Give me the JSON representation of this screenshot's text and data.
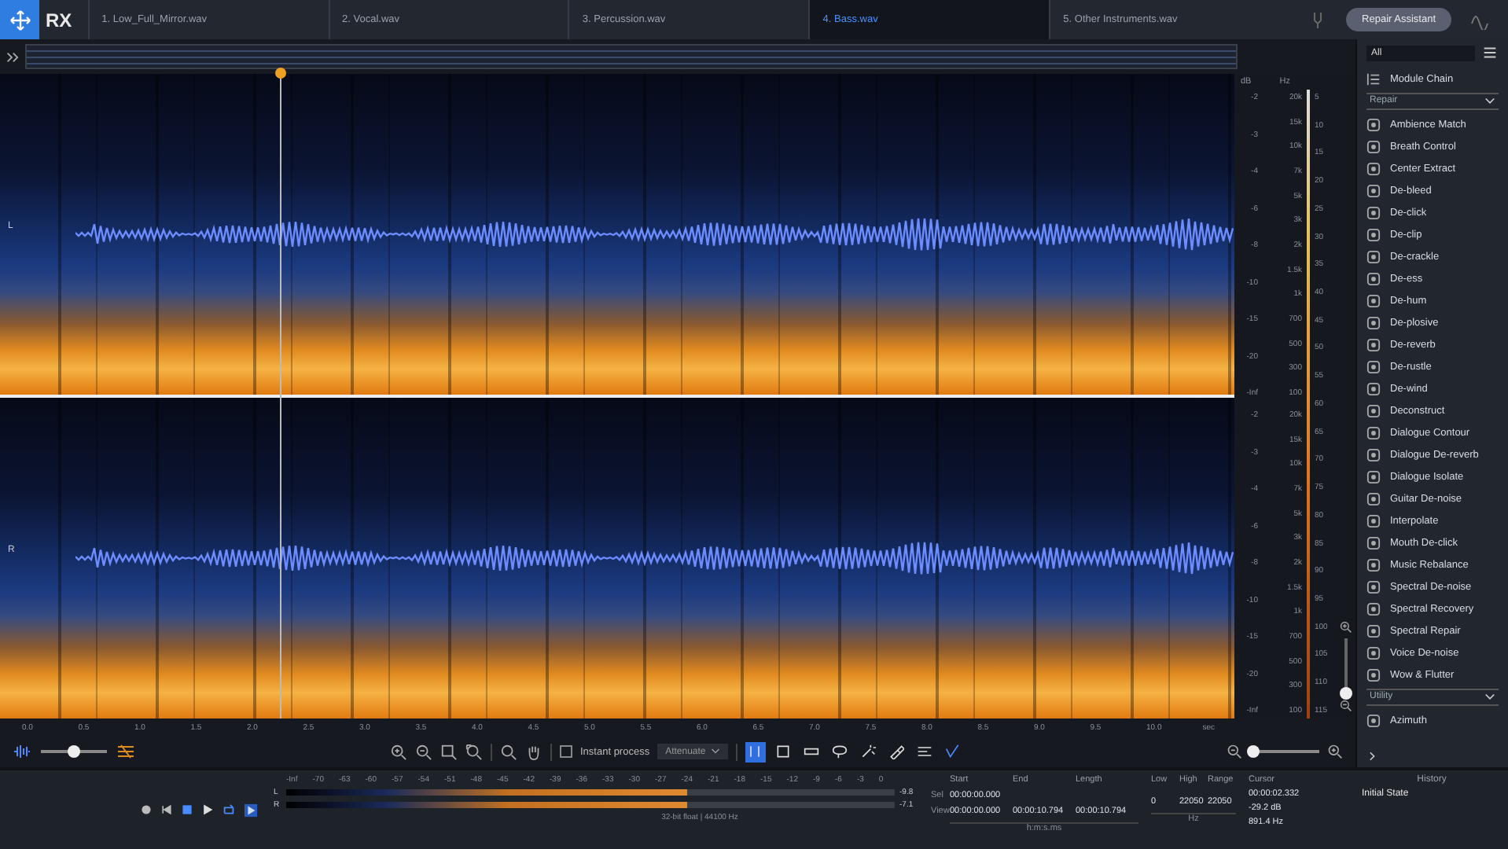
{
  "app": {
    "logo": "RX"
  },
  "tabs": [
    {
      "label": "1. Low_Full_Mirror.wav",
      "selected": false
    },
    {
      "label": "2. Vocal.wav",
      "selected": false
    },
    {
      "label": "3. Percussion.wav",
      "selected": false
    },
    {
      "label": "4. Bass.wav",
      "selected": true
    },
    {
      "label": "5. Other Instruments.wav",
      "selected": false
    }
  ],
  "repair_assistant": "Repair Assistant",
  "channels": [
    {
      "label": "L",
      "db": [
        "-2",
        "-3",
        "-4",
        "-6",
        "-8",
        "-10",
        "-15",
        "-20",
        "-Inf"
      ],
      "hz": [
        "20k",
        "15k",
        "10k",
        "7k",
        "5k",
        "3k",
        "2k",
        "1.5k",
        "1k",
        "700",
        "500",
        "300",
        "100"
      ]
    },
    {
      "label": "R",
      "db": [
        "-2",
        "-3",
        "-4",
        "-6",
        "-8",
        "-10",
        "-15",
        "-20",
        "-Inf"
      ],
      "hz": [
        "20k",
        "15k",
        "10k",
        "7k",
        "5k",
        "3k",
        "2k",
        "1.5k",
        "1k",
        "700",
        "500",
        "300",
        "100"
      ]
    }
  ],
  "scales": {
    "db_header": "dB",
    "hz_header": "Hz",
    "meter": [
      "5",
      "10",
      "15",
      "20",
      "25",
      "30",
      "35",
      "40",
      "45",
      "50",
      "55",
      "60",
      "65",
      "70",
      "75",
      "80",
      "85",
      "90",
      "95",
      "100",
      "105",
      "110",
      "115"
    ]
  },
  "time_ruler": {
    "ticks": [
      "0.0",
      "0.5",
      "1.0",
      "1.5",
      "2.0",
      "2.5",
      "3.0",
      "3.5",
      "4.0",
      "4.5",
      "5.0",
      "5.5",
      "6.0",
      "6.5",
      "7.0",
      "7.5",
      "8.0",
      "8.5",
      "9.0",
      "9.5",
      "10.0"
    ],
    "unit": "sec"
  },
  "toolbar": {
    "view_slider": {
      "level": 0.5
    },
    "instant_process": {
      "label": "Instant process",
      "checked": false
    },
    "mode": "Attenuate",
    "tools": [
      {
        "kind": "time",
        "selected": true
      },
      {
        "kind": "rect",
        "selected": false
      },
      {
        "kind": "freq",
        "selected": false
      },
      {
        "kind": "lasso",
        "selected": false
      },
      {
        "kind": "wand",
        "selected": false
      },
      {
        "kind": "brush",
        "selected": false
      },
      {
        "kind": "harmonic",
        "selected": false
      },
      {
        "kind": "pencil",
        "selected": false
      }
    ],
    "zoom_slider": {
      "level": 0.05
    }
  },
  "meter": {
    "scale": [
      "-Inf",
      "-70",
      "-63",
      "-60",
      "-57",
      "-54",
      "-51",
      "-48",
      "-45",
      "-42",
      "-39",
      "-36",
      "-33",
      "-30",
      "-27",
      "-24",
      "-21",
      "-18",
      "-15",
      "-12",
      "-9",
      "-6",
      "-3",
      "0"
    ],
    "channels": [
      {
        "label": "L",
        "level": 0.66,
        "peak": "-9.8"
      },
      {
        "label": "R",
        "level": 0.66,
        "peak": "-7.1"
      }
    ],
    "format": "32-bit float | 44100 Hz"
  },
  "selection": {
    "headers": [
      "Start",
      "End",
      "Length"
    ],
    "rows": [
      {
        "label": "Sel",
        "values": [
          "00:00:00.000"
        ]
      },
      {
        "label": "View",
        "values": [
          "00:00:00.000",
          "00:00:10.794",
          "00:00:10.794"
        ]
      }
    ],
    "unit": "h:m:s.ms"
  },
  "frequency": {
    "headers": [
      "Low",
      "High",
      "Range"
    ],
    "values": [
      "0",
      "22050",
      "22050"
    ],
    "unit": "Hz"
  },
  "cursor": {
    "header": "Cursor",
    "values": [
      "00:00:02.332",
      "-29.2 dB",
      "891.4 Hz"
    ]
  },
  "modules": {
    "filter": "All",
    "chain": "Module Chain",
    "sections": [
      {
        "title": "Repair",
        "expanded": true,
        "items": [
          "Ambience Match",
          "Breath Control",
          "Center Extract",
          "De-bleed",
          "De-click",
          "De-clip",
          "De-crackle",
          "De-ess",
          "De-hum",
          "De-plosive",
          "De-reverb",
          "De-rustle",
          "De-wind",
          "Deconstruct",
          "Dialogue Contour",
          "Dialogue De-reverb",
          "Dialogue Isolate",
          "Guitar De-noise",
          "Interpolate",
          "Mouth De-click",
          "Music Rebalance",
          "Spectral De-noise",
          "Spectral Recovery",
          "Spectral Repair",
          "Voice De-noise",
          "Wow & Flutter"
        ]
      },
      {
        "title": "Utility",
        "expanded": true,
        "items": [
          "Azimuth"
        ]
      }
    ]
  },
  "history": {
    "title": "History",
    "items": [
      "Initial State"
    ]
  }
}
